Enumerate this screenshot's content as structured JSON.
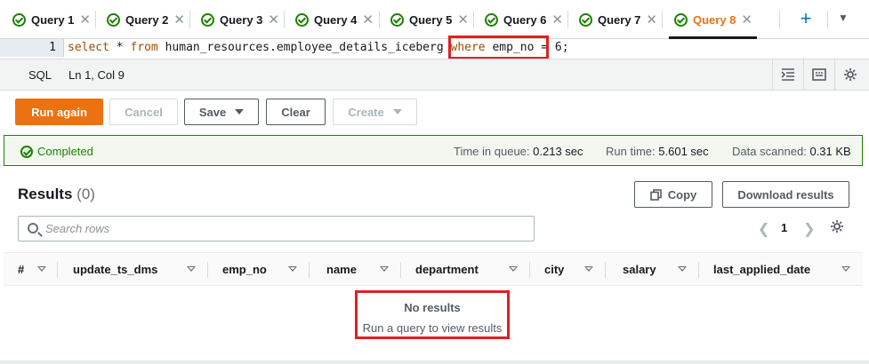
{
  "tabs": [
    {
      "label": "Query 1",
      "status": "completed"
    },
    {
      "label": "Query 2",
      "status": "completed"
    },
    {
      "label": "Query 3",
      "status": "completed"
    },
    {
      "label": "Query 4",
      "status": "completed"
    },
    {
      "label": "Query 5",
      "status": "completed"
    },
    {
      "label": "Query 6",
      "status": "completed"
    },
    {
      "label": "Query 7",
      "status": "completed"
    },
    {
      "label": "Query 8",
      "status": "completed",
      "active": true
    }
  ],
  "tab_icons": {
    "close": "close-icon",
    "add": "plus-icon",
    "more": "caret-down-icon"
  },
  "editor": {
    "line_number": "1",
    "kw_select": "select",
    "star": " * ",
    "kw_from": "from",
    "table": " human_resources.employee_details_iceberg ",
    "kw_where": "where",
    "condition": " emp_no = 6;"
  },
  "statusbar": {
    "language": "SQL",
    "position": "Ln 1, Col 9"
  },
  "actions": {
    "run_again": "Run again",
    "cancel": "Cancel",
    "save": "Save",
    "clear": "Clear",
    "create": "Create"
  },
  "banner": {
    "status": "Completed",
    "queue_label": "Time in queue:",
    "queue_value": "0.213 sec",
    "run_label": "Run time:",
    "run_value": "5.601 sec",
    "scan_label": "Data scanned:",
    "scan_value": "0.31 KB"
  },
  "results": {
    "title": "Results",
    "count": "(0)",
    "copy": "Copy",
    "download": "Download results",
    "search_placeholder": "Search rows",
    "page": "1",
    "columns": [
      "#",
      "update_ts_dms",
      "emp_no",
      "name",
      "department",
      "city",
      "salary",
      "last_applied_date"
    ],
    "empty_title": "No results",
    "empty_subtitle": "Run a query to view results"
  },
  "colors": {
    "accent": "#ec7211",
    "success": "#1d8102",
    "highlight": "#e02020"
  }
}
